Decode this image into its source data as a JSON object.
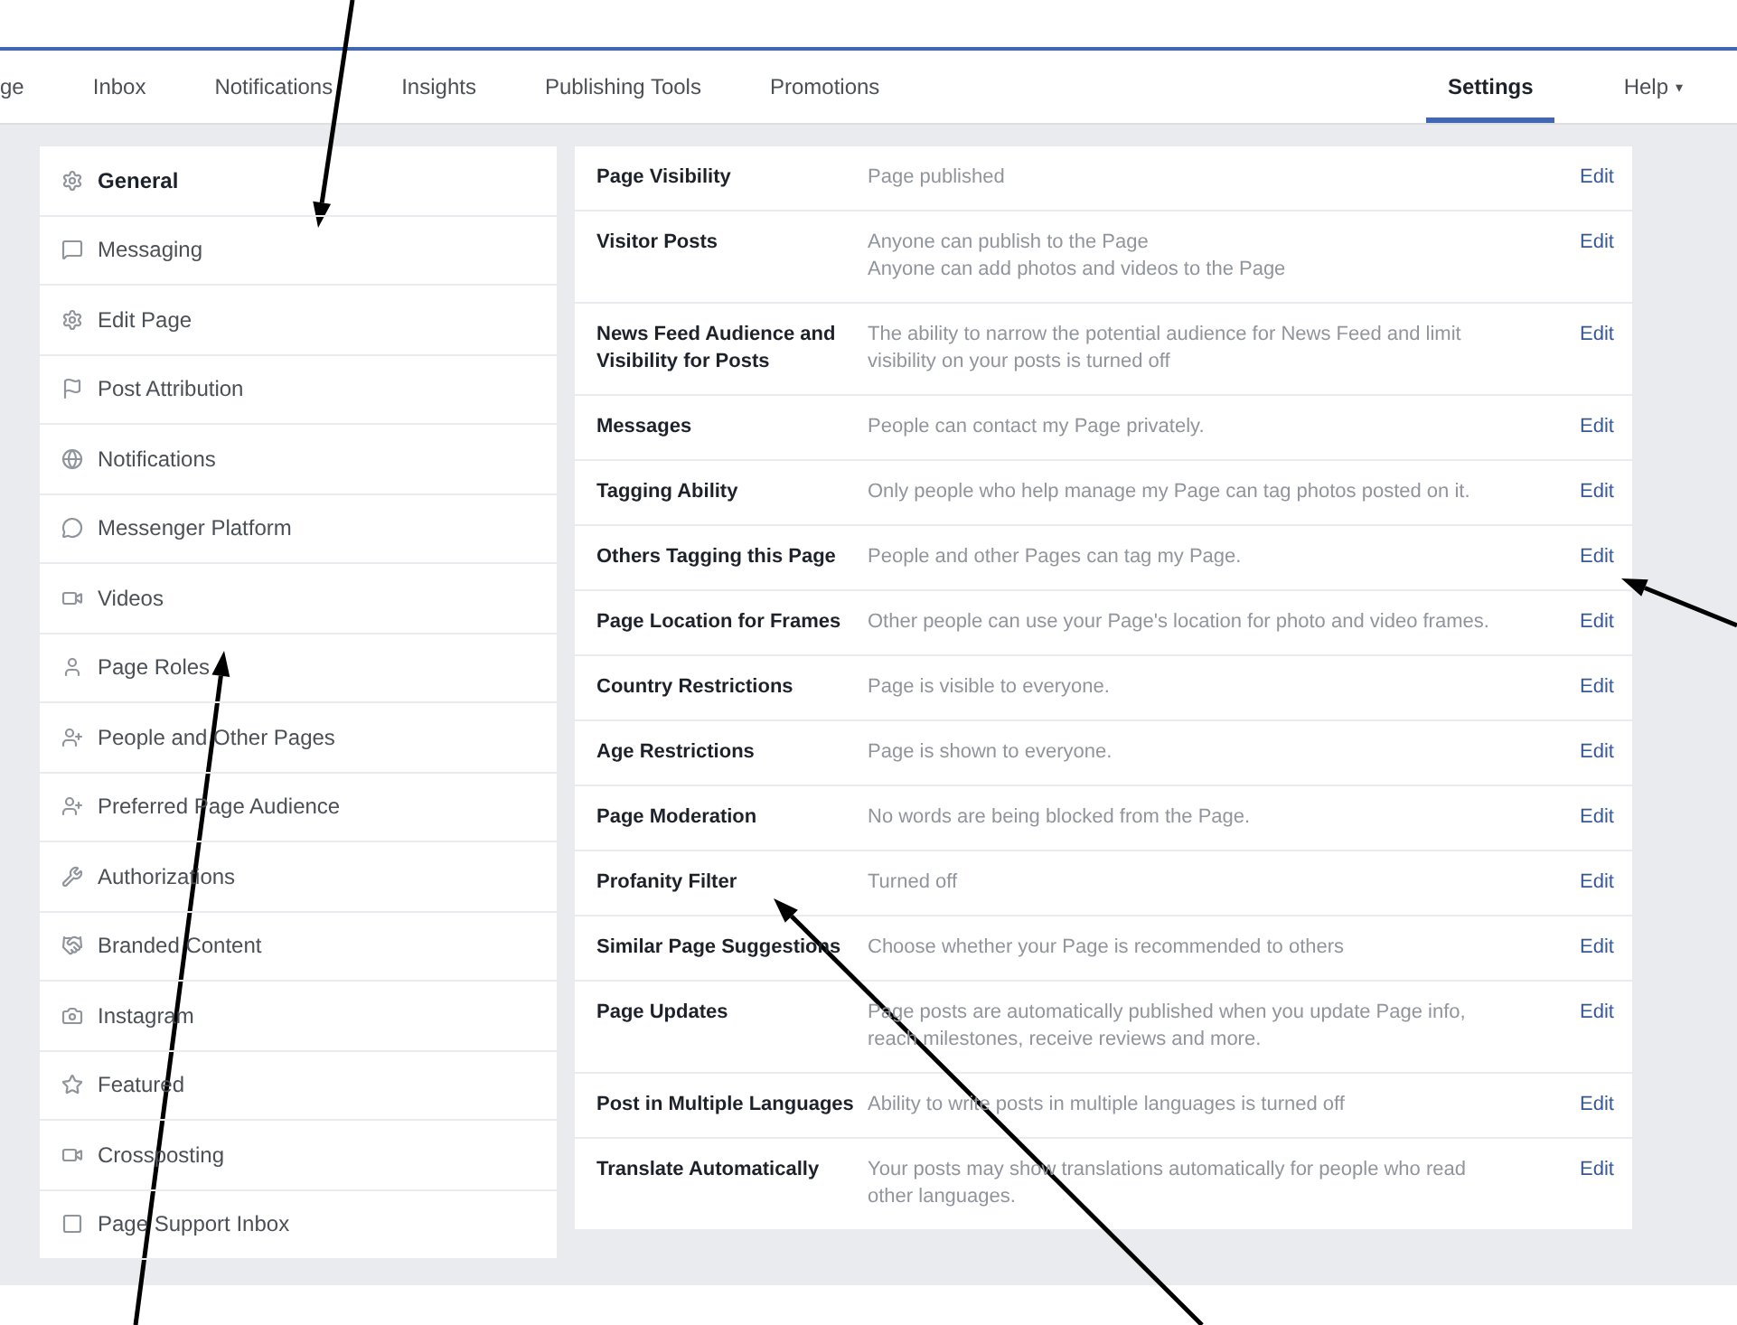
{
  "nav": {
    "tabs": [
      {
        "label": "ge",
        "selected": false
      },
      {
        "label": "Inbox",
        "selected": false
      },
      {
        "label": "Notifications",
        "selected": false
      },
      {
        "label": "Insights",
        "selected": false
      },
      {
        "label": "Publishing Tools",
        "selected": false
      },
      {
        "label": "Promotions",
        "selected": false
      }
    ],
    "right_tabs": [
      {
        "label": "Settings",
        "selected": true
      },
      {
        "label": "Help",
        "selected": false,
        "caret": "▾"
      }
    ]
  },
  "sidebar": {
    "items": [
      {
        "label": "General",
        "selected": true
      },
      {
        "label": "Messaging",
        "selected": false
      },
      {
        "label": "Edit Page",
        "selected": false
      },
      {
        "label": "Post Attribution",
        "selected": false
      },
      {
        "label": "Notifications",
        "selected": false
      },
      {
        "label": "Messenger Platform",
        "selected": false
      },
      {
        "label": "Videos",
        "selected": false
      },
      {
        "label": "Page Roles",
        "selected": false
      },
      {
        "label": "People and Other Pages",
        "selected": false
      },
      {
        "label": "Preferred Page Audience",
        "selected": false
      },
      {
        "label": "Authorizations",
        "selected": false
      },
      {
        "label": "Branded Content",
        "selected": false
      },
      {
        "label": "Instagram",
        "selected": false
      },
      {
        "label": "Featured",
        "selected": false
      },
      {
        "label": "Crossposting",
        "selected": false
      },
      {
        "label": "Page Support Inbox",
        "selected": false
      }
    ]
  },
  "settings": {
    "rows": [
      {
        "name": "Page Visibility",
        "value": [
          "Page published"
        ],
        "action": "Edit"
      },
      {
        "name": "Visitor Posts",
        "value": [
          "Anyone can publish to the Page",
          "Anyone can add photos and videos to the Page"
        ],
        "action": "Edit"
      },
      {
        "name": "News Feed Audience and Visibility for Posts",
        "value": [
          "The ability to narrow the potential audience for News Feed and limit visibility on your posts is turned off"
        ],
        "action": "Edit"
      },
      {
        "name": "Messages",
        "value": [
          "People can contact my Page privately."
        ],
        "action": "Edit"
      },
      {
        "name": "Tagging Ability",
        "value": [
          "Only people who help manage my Page can tag photos posted on it."
        ],
        "action": "Edit"
      },
      {
        "name": "Others Tagging this Page",
        "value": [
          "People and other Pages can tag my Page."
        ],
        "action": "Edit"
      },
      {
        "name": "Page Location for Frames",
        "value": [
          "Other people can use your Page's location for photo and video frames."
        ],
        "action": "Edit"
      },
      {
        "name": "Country Restrictions",
        "value": [
          "Page is visible to everyone."
        ],
        "action": "Edit"
      },
      {
        "name": "Age Restrictions",
        "value": [
          "Page is shown to everyone."
        ],
        "action": "Edit"
      },
      {
        "name": "Page Moderation",
        "value": [
          "No words are being blocked from the Page."
        ],
        "action": "Edit"
      },
      {
        "name": "Profanity Filter",
        "value": [
          "Turned off"
        ],
        "action": "Edit"
      },
      {
        "name": "Similar Page Suggestions",
        "value": [
          "Choose whether your Page is recommended to others"
        ],
        "action": "Edit"
      },
      {
        "name": "Page Updates",
        "value": [
          "Page posts are automatically published when you update Page info, reach milestones, receive reviews and more."
        ],
        "action": "Edit"
      },
      {
        "name": "Post in Multiple Languages",
        "value": [
          "Ability to write posts in multiple languages is turned off"
        ],
        "action": "Edit"
      },
      {
        "name": "Translate Automatically",
        "value": [
          "Your posts may show translations automatically for people who read other languages."
        ],
        "action": "Edit"
      }
    ]
  }
}
